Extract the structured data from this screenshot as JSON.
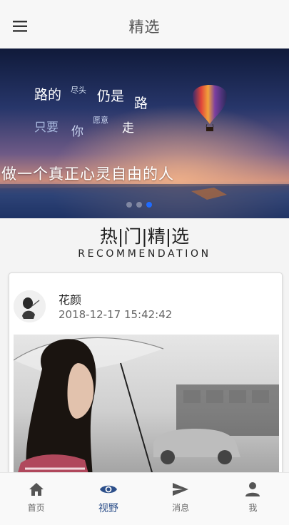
{
  "header": {
    "title": "精选",
    "menu_icon": "menu-icon"
  },
  "banner": {
    "line1": [
      "路的",
      "尽头",
      "仍是",
      "路"
    ],
    "line2": [
      "只要",
      "你",
      "愿意",
      "走"
    ],
    "slogan": "做一个真正心灵自由的人",
    "dots_total": 3,
    "dots_active_index": 2,
    "accent_color": "#1f6bff"
  },
  "section": {
    "title": "热|门|精|选",
    "subtitle": "RECOMMENDATION"
  },
  "card": {
    "author": "花颜",
    "timestamp": "2018-12-17 15:42:42"
  },
  "tabbar": {
    "active_color": "#2c4f8a",
    "items": [
      {
        "label": "首页",
        "icon": "home-icon"
      },
      {
        "label": "视野",
        "icon": "eye-icon"
      },
      {
        "label": "消息",
        "icon": "send-icon"
      },
      {
        "label": "我",
        "icon": "person-icon"
      }
    ],
    "active_index": 1
  }
}
